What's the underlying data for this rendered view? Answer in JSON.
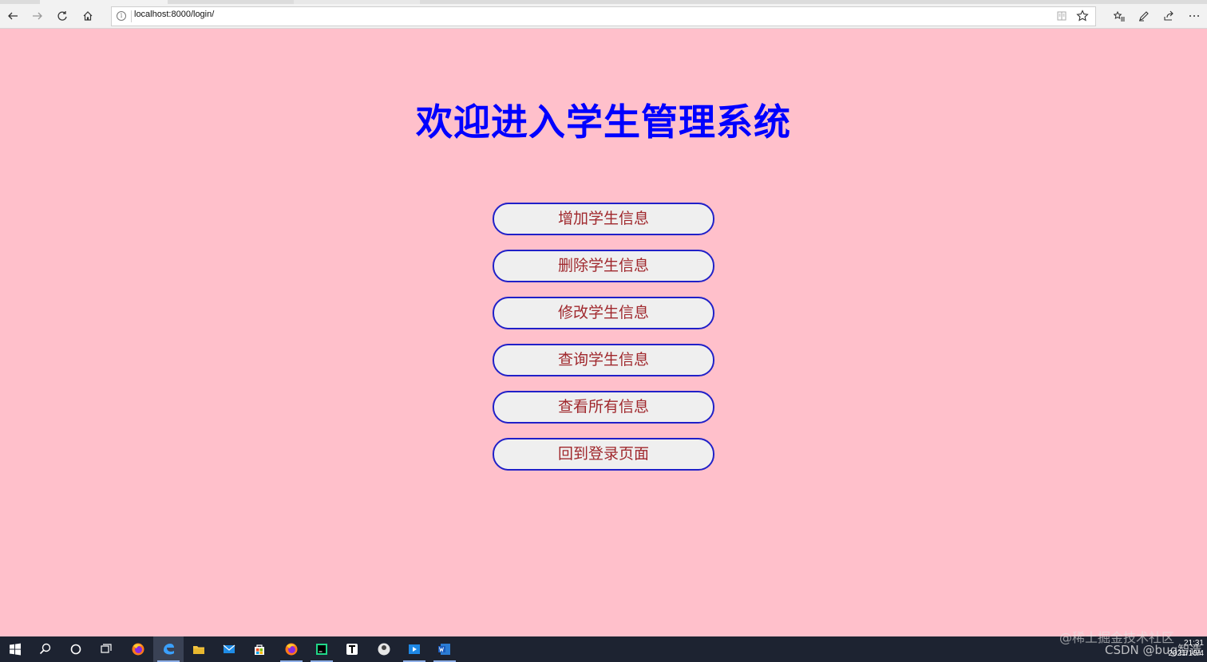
{
  "browser": {
    "url": "localhost:8000/login/",
    "icons": [
      "back-arrow-icon",
      "forward-arrow-icon",
      "refresh-icon",
      "home-icon",
      "info-icon",
      "reading-view-icon",
      "star-icon",
      "favorites-icon",
      "pen-icon",
      "share-icon",
      "more-icon"
    ]
  },
  "page": {
    "title": "欢迎进入学生管理系统",
    "buttons": [
      {
        "label": "增加学生信息"
      },
      {
        "label": "删除学生信息"
      },
      {
        "label": "修改学生信息"
      },
      {
        "label": "查询学生信息"
      },
      {
        "label": "查看所有信息"
      },
      {
        "label": "回到登录页面"
      }
    ]
  },
  "taskbar": {
    "clock_time": "21:31",
    "clock_date": "2021/10/4",
    "watermark_1": "@稀土掘金技术社区",
    "watermark_2": "CSDN @bug智造",
    "apps": [
      "windows-start-icon",
      "search-icon",
      "cortana-icon",
      "task-view-icon",
      "firefox-icon",
      "edge-icon",
      "file-explorer-icon",
      "mail-icon",
      "store-icon",
      "firefox-icon-2",
      "pycharm-icon",
      "typora-icon",
      "app-icon",
      "media-icon",
      "word-icon"
    ]
  },
  "colors": {
    "page_bg": "#ffc0cb",
    "title": "#0000ff",
    "button_text": "#a0282d",
    "button_border": "#2020c8"
  }
}
